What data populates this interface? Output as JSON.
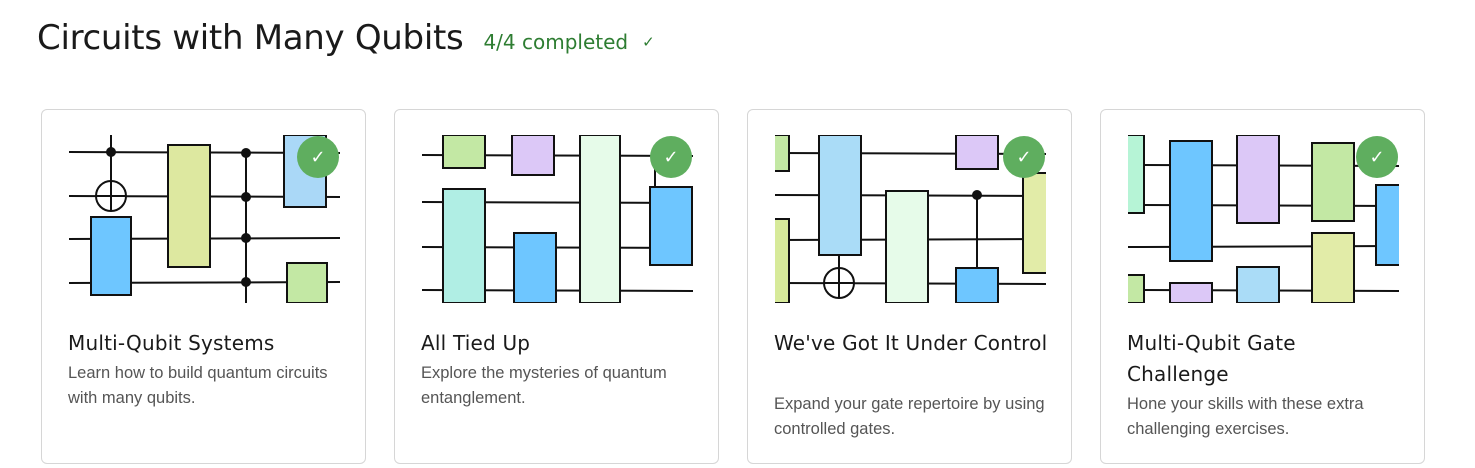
{
  "header": {
    "title": "Circuits with Many Qubits",
    "progress": "4/4 completed",
    "progress_icon": "check-icon",
    "accent": "#2e7d32"
  },
  "cards": [
    {
      "title": "Multi-Qubit Systems",
      "description": "Learn how to build quantum circuits with many qubits.",
      "completed": true
    },
    {
      "title": "All Tied Up",
      "description": "Explore the mysteries of quantum entanglement.",
      "completed": true
    },
    {
      "title": "We've Got It Under Control",
      "description": "Expand your gate repertoire by using controlled gates.",
      "completed": true
    },
    {
      "title": "Multi-Qubit Gate Challenge",
      "description": "Hone your skills with these extra challenging exercises.",
      "completed": true
    }
  ],
  "badge_color": "#5fae5f"
}
